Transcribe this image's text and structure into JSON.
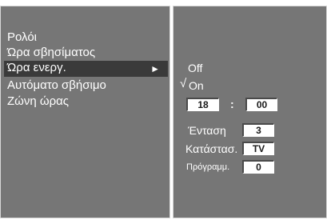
{
  "menu": {
    "items": [
      {
        "label": "Ρολόι"
      },
      {
        "label": "Ώρα σβησίματος"
      },
      {
        "label": "Ώρα ενεργ.",
        "arrow": "►"
      },
      {
        "label": "Αυτόματο σβήσιμο"
      },
      {
        "label": "Ζώνη ώρας"
      }
    ],
    "selected_index": 2
  },
  "submenu": {
    "off_label": "Off",
    "on_label": "On",
    "check_mark": "√",
    "time": {
      "hour": "18",
      "separator": ":",
      "minute": "00"
    },
    "volume": {
      "label": "Ένταση",
      "value": "3"
    },
    "mode": {
      "label": "Κατάστασ.",
      "value": "TV"
    },
    "program": {
      "label": "Πρόγραμμ.",
      "value": "0"
    }
  },
  "colors": {
    "panel": "#767676",
    "highlight": "#3a3a3a",
    "text": "#ffffff"
  }
}
